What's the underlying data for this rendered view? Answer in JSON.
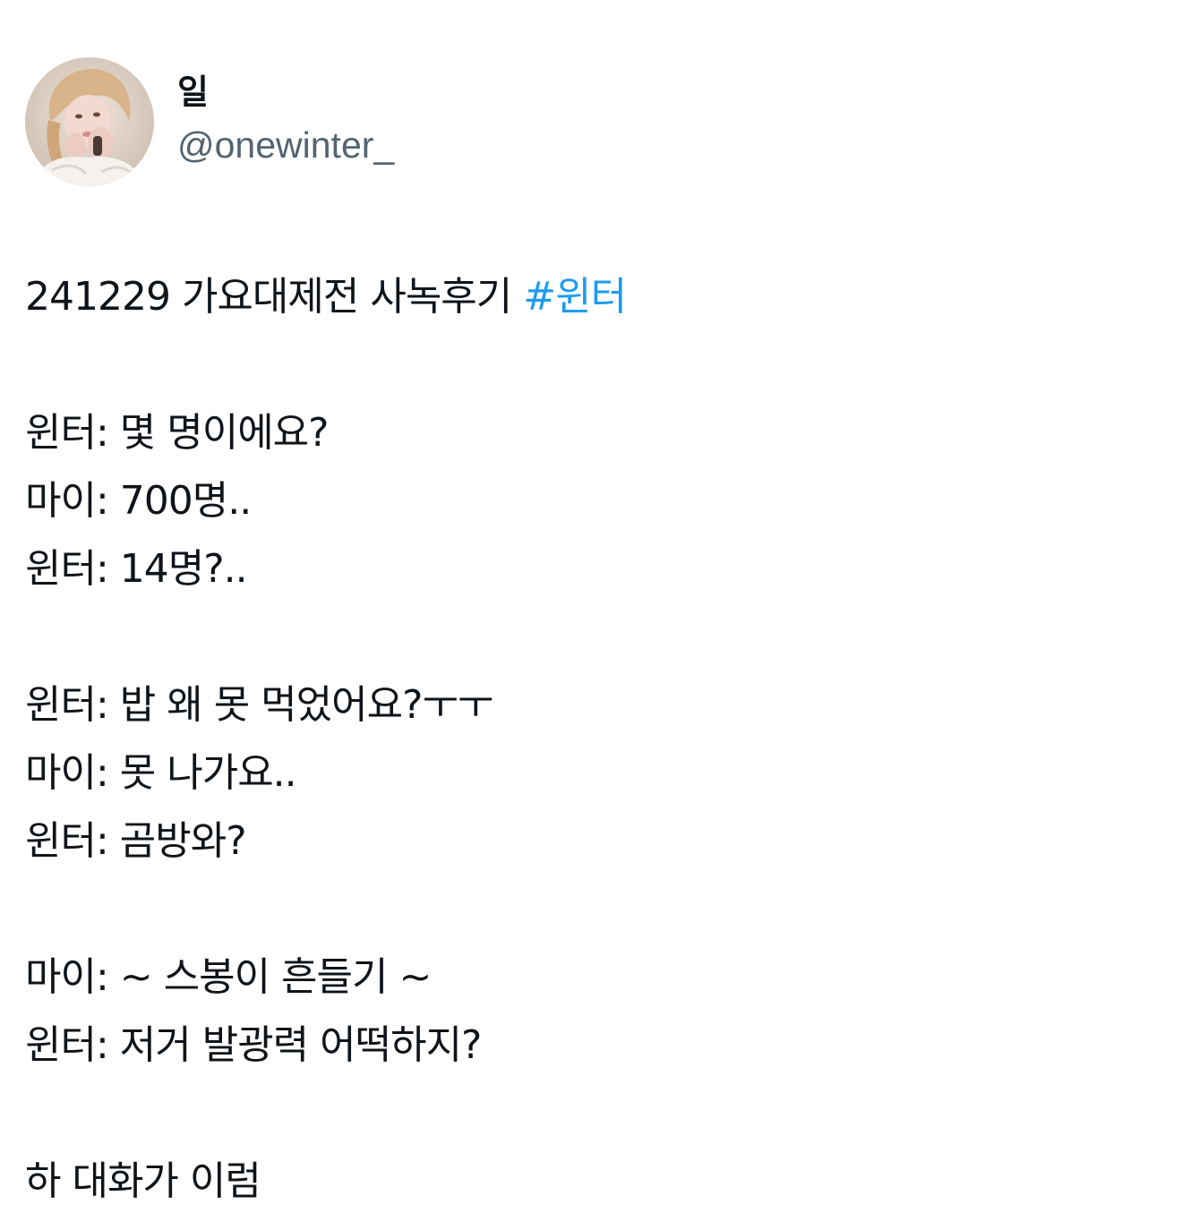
{
  "author": {
    "display_name": "일",
    "handle": "@onewinter_",
    "avatar_icon": "profile-photo"
  },
  "tweet": {
    "title_text": "241229 가요대제전 사녹후기 ",
    "hashtag": "#윈터",
    "lines": [
      "윈터: 몇 명이에요?",
      "마이: 700명..",
      "윈터: 14명?..",
      "",
      "윈터: 밥 왜 못 먹었어요?ㅜㅜ",
      "마이: 못 나가요..",
      "윈터: 곰방와?",
      "",
      "마이: ~ 스봉이 흔들기 ~",
      "윈터: 저거 발광력 어떡하지?",
      "",
      "하 대화가 이럼"
    ]
  },
  "colors": {
    "text": "#0f1419",
    "secondary": "#536471",
    "link": "#1d9bf0"
  }
}
